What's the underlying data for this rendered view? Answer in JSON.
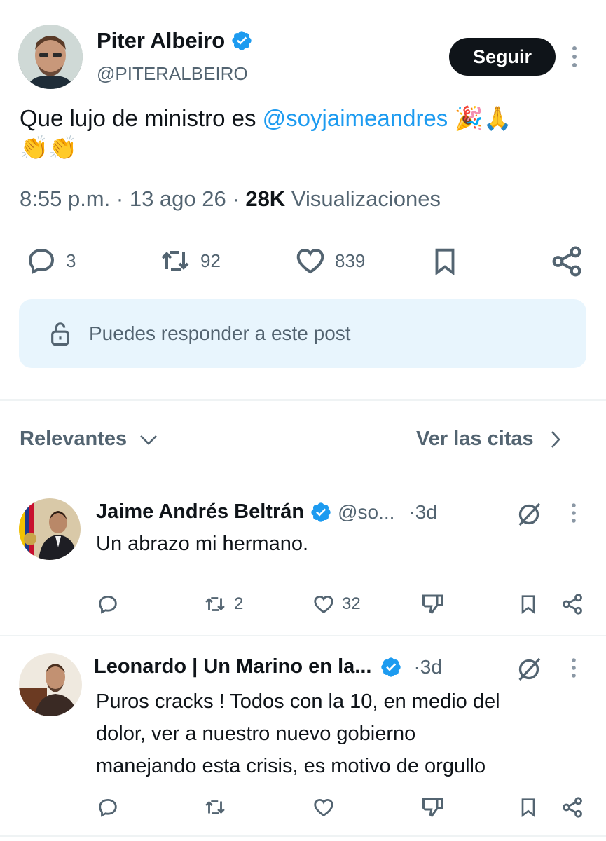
{
  "colors": {
    "accent": "#1d9bf0",
    "text": "#0f1419",
    "muted": "#536471",
    "notice_bg": "#e8f5fd"
  },
  "post": {
    "author_name": "Piter Albeiro",
    "author_handle": "@PITERALBEIRO",
    "follow_label": "Seguir",
    "text_prefix": "Que lujo de ministro es ",
    "mention": "@soyjaimeandres",
    "emoji_line1": "🎉🙏",
    "emoji_line2": "👏👏",
    "time": "8:55 p.m.",
    "sep1": "·",
    "date": "13 ago 26",
    "sep2": "·",
    "views_count": "28K",
    "views_label": "Visualizaciones",
    "replies": "3",
    "reposts": "92",
    "likes": "839"
  },
  "notice": {
    "text": "Puedes responder a este post",
    "icon": "lock-open-icon"
  },
  "filter": {
    "sort_label": "Relevantes",
    "quotes_label": "Ver las citas"
  },
  "replies": [
    {
      "name": "Jaime Andrés Beltrán",
      "handle": "@so...",
      "time": "·3d",
      "text": "Un abrazo mi hermano.",
      "replies": "",
      "reposts": "2",
      "likes": "32"
    },
    {
      "name": "Leonardo | Un Marino en la...",
      "time": "·3d",
      "text_line1": "Puros cracks ! Todos con la 10, en medio del",
      "text_line2": "dolor, ver a nuestro nuevo gobierno",
      "text_line3": "manejando esta crisis, es motivo de orgullo",
      "replies": "",
      "reposts": "",
      "likes": ""
    }
  ]
}
